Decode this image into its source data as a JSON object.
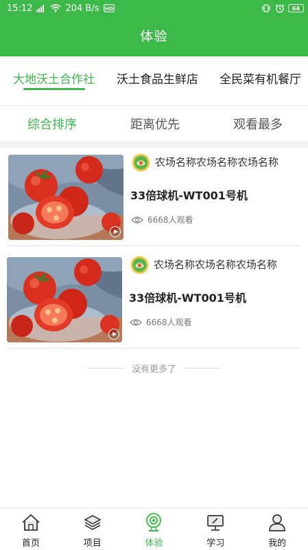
{
  "status_bar": {
    "time": "15:12",
    "speed": "204 B/s",
    "battery": "64"
  },
  "header": {
    "title": "体验"
  },
  "shop_tabs": [
    {
      "label": "大地沃土合作社",
      "active": true
    },
    {
      "label": "沃土食品生鲜店",
      "active": false
    },
    {
      "label": "全民菜有机餐厅",
      "active": false
    }
  ],
  "sort_tabs": [
    {
      "label": "综合排序",
      "active": true
    },
    {
      "label": "距离优先",
      "active": false
    },
    {
      "label": "观看最多",
      "active": false
    }
  ],
  "cards": [
    {
      "farm_name": "农场名称农场名称农场名称",
      "title": "33倍球机-WT001号机",
      "views": "6668人观看",
      "thumb_icon": "tomato-photo",
      "play_icon": "play-icon"
    },
    {
      "farm_name": "农场名称农场名称农场名称",
      "title": "33倍球机-WT001号机",
      "views": "6668人观看",
      "thumb_icon": "tomato-photo",
      "play_icon": "play-icon"
    }
  ],
  "footer_text": "没有更多了",
  "tabbar": [
    {
      "label": "首页",
      "icon": "home-icon",
      "active": false
    },
    {
      "label": "项目",
      "icon": "layers-icon",
      "active": false
    },
    {
      "label": "体验",
      "icon": "camera-icon",
      "active": true
    },
    {
      "label": "学习",
      "icon": "monitor-icon",
      "active": false
    },
    {
      "label": "我的",
      "icon": "user-icon",
      "active": false
    }
  ],
  "colors": {
    "accent": "#3cb949",
    "text": "#333333",
    "muted": "#999999"
  }
}
